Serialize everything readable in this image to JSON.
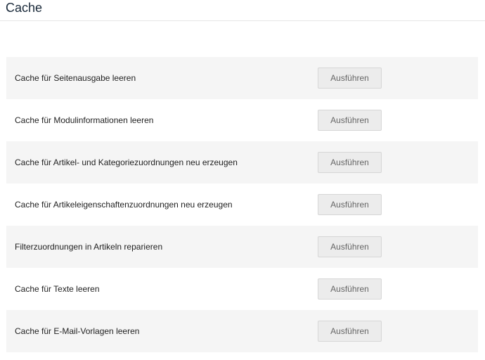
{
  "header": {
    "title": "Cache"
  },
  "cache": {
    "rows": [
      {
        "label": "Cache für Seitenausgabe leeren",
        "button": "Ausführen"
      },
      {
        "label": "Cache für Modulinformationen leeren",
        "button": "Ausführen"
      },
      {
        "label": "Cache für Artikel- und Kategoriezuordnungen neu erzeugen",
        "button": "Ausführen"
      },
      {
        "label": "Cache für Artikeleigenschaftenzuordnungen neu erzeugen",
        "button": "Ausführen"
      },
      {
        "label": "Filterzuordnungen in Artikeln reparieren",
        "button": "Ausführen"
      },
      {
        "label": "Cache für Texte leeren",
        "button": "Ausführen"
      },
      {
        "label": "Cache für E-Mail-Vorlagen leeren",
        "button": "Ausführen"
      }
    ]
  }
}
